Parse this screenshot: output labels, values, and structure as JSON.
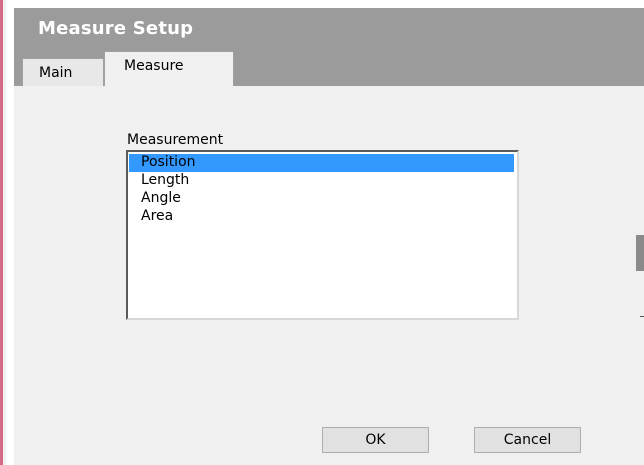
{
  "window": {
    "title": "Measure Setup"
  },
  "tabs": [
    {
      "label": "Main",
      "selected": false
    },
    {
      "label": "Measure",
      "selected": true
    }
  ],
  "measurement": {
    "label": "Measurement",
    "items": [
      "Position",
      "Length",
      "Angle",
      "Area"
    ],
    "selected": "Position"
  },
  "buttons": {
    "ok_label": "OK",
    "cancel_label": "Cancel"
  },
  "colors": {
    "title_bar": "#9b9b9b",
    "selection": "#3399ff",
    "window_accent_edge": "#d46a8a"
  }
}
